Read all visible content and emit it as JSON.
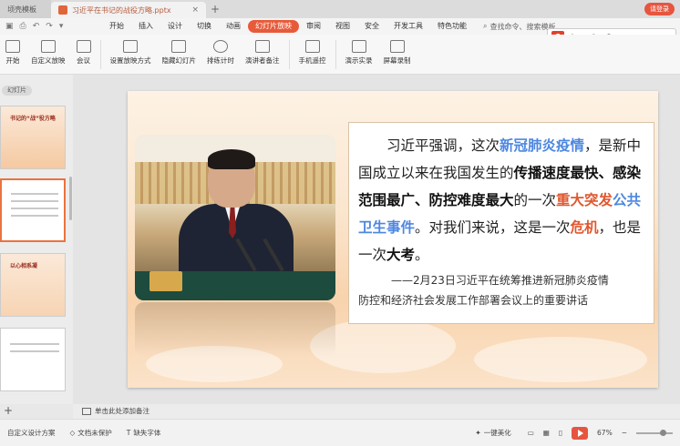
{
  "tabs": [
    {
      "label": "顷壳模板"
    },
    {
      "label": "习近平在书记的战役方略.pptx"
    }
  ],
  "login_label": "请登录",
  "menu": [
    "开始",
    "插入",
    "设计",
    "切换",
    "动画",
    "幻灯片放映",
    "审阅",
    "视图",
    "安全",
    "开发工具",
    "特色功能"
  ],
  "active_menu": "幻灯片放映",
  "search_label": "查找命令、搜索模板",
  "ribbon": [
    "开始",
    "自定义放映",
    "会议",
    "设置放映方式",
    "隐藏幻灯片",
    "排练计时",
    "演讲者备注",
    "手机遥控",
    "演示实录",
    "屏幕录制"
  ],
  "ime": {
    "logo": "S",
    "items": [
      "中",
      "·,",
      "☺",
      "🎤",
      "⌨"
    ]
  },
  "pane_tab": "幻灯片",
  "thumbs": {
    "t1_title": "书记的“战”役方略",
    "t3_title": "以心相系凝"
  },
  "slide": {
    "para_segments": [
      {
        "t": "习近平强调，这次",
        "c": ""
      },
      {
        "t": "新冠肺炎疫情",
        "c": "blue"
      },
      {
        "t": "，是新中国成立以来在我国发生的",
        "c": ""
      },
      {
        "t": "传播速度最快、感染范围最广、防控难度最大",
        "c": "b"
      },
      {
        "t": "的一次",
        "c": ""
      },
      {
        "t": "重大突发",
        "c": "red"
      },
      {
        "t": "公共卫生事件",
        "c": "blue"
      },
      {
        "t": "。对我们来说，这是一次",
        "c": ""
      },
      {
        "t": "危机",
        "c": "red"
      },
      {
        "t": "，也是一次",
        "c": ""
      },
      {
        "t": "大考",
        "c": "b"
      },
      {
        "t": "。",
        "c": ""
      }
    ],
    "source_line1": "——2月23日习近平在统筹推进新冠肺炎疫情",
    "source_line2": "防控和经济社会发展工作部署会议上的重要讲话"
  },
  "notes_label": "单击此处添加备注",
  "status": {
    "design": "自定义设计方案",
    "protect": "文档未保护",
    "font": "缺失字体",
    "beautify": "一键美化",
    "zoom": "67%"
  },
  "colors": {
    "accent": "#e6553f",
    "blue_text": "#4d87e0",
    "red_text": "#e0572f"
  }
}
